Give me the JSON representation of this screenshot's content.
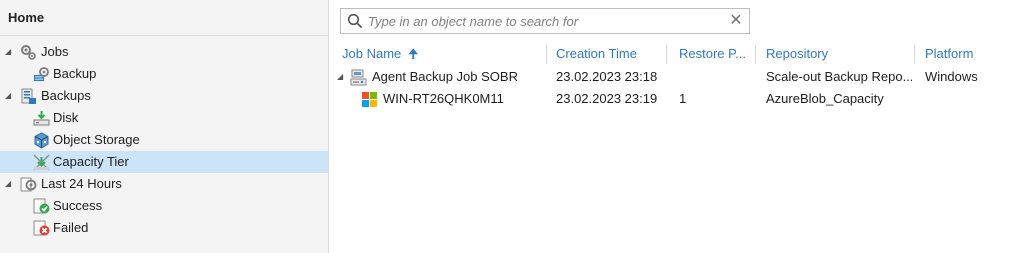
{
  "nav": {
    "header": "Home",
    "items": [
      {
        "label": "Jobs",
        "icon": "jobs-gear-icon"
      },
      {
        "label": "Backup",
        "icon": "backup-job-icon"
      },
      {
        "label": "Backups",
        "icon": "backups-icon"
      },
      {
        "label": "Disk",
        "icon": "disk-icon"
      },
      {
        "label": "Object Storage",
        "icon": "object-storage-icon"
      },
      {
        "label": "Capacity Tier",
        "icon": "capacity-tier-icon",
        "selected": true
      },
      {
        "label": "Last 24 Hours",
        "icon": "last-24-hours-icon"
      },
      {
        "label": "Success",
        "icon": "success-icon"
      },
      {
        "label": "Failed",
        "icon": "failed-icon"
      }
    ]
  },
  "search": {
    "placeholder": "Type in an object name to search for",
    "value": ""
  },
  "table": {
    "columns": [
      "Job Name",
      "Creation Time",
      "Restore P...",
      "Repository",
      "Platform"
    ],
    "sort_column": "Job Name",
    "sort_direction": "ascending",
    "rows": [
      {
        "name": "Agent Backup Job SOBR",
        "creation_time": "23.02.2023 23:18",
        "restore_points": "",
        "repository": "Scale-out Backup Repo...",
        "platform": "Windows",
        "icon": "agent-job-icon",
        "expanded": true
      },
      {
        "name": "WIN-RT26QHK0M11",
        "creation_time": "23.02.2023 23:19",
        "restore_points": "1",
        "repository": "AzureBlob_Capacity",
        "platform": "",
        "icon": "windows-machine-icon"
      }
    ]
  },
  "colors": {
    "accent": "#2e7ac2",
    "selected_row": "#cce4f7",
    "nav_bg": "#f4f4f4"
  }
}
